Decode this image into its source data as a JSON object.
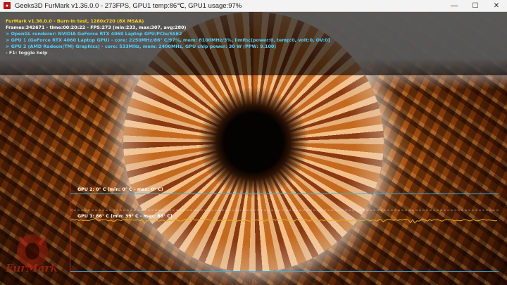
{
  "window": {
    "title": "Geeks3D FurMark v1.36.0.0 - 273FPS, GPU1 temp:86℃, GPU1 usage:97%",
    "icon": "furmark-app-icon",
    "controls": {
      "minimize": "—",
      "maximize": "☐",
      "close": "✕"
    }
  },
  "hud": {
    "lines": [
      {
        "text": "FurMark v1.36.0.0 - Burn-in test, 1280x720 (8X MSAA)",
        "color": "#ffd21a"
      },
      {
        "text": "Frames:342671 - time:00:20:22 - FPS:273 (min:233, max:307, avg:280)",
        "color": "#ffffff"
      },
      {
        "text": "> OpenGL renderer: NVIDIA GeForce RTX 4060 Laptop GPU/PCIe/SSE2",
        "color": "#4fd0ff"
      },
      {
        "text": "> GPU 1 (GeForce RTX 4060 Laptop GPU) - core: 2250MHz/86° C/97%, mem: 8100MHz/3%, limits:[power:0, temp:0, volt:0, OV:0]",
        "color": "#4fd0ff"
      },
      {
        "text": "> GPU 2 (AMD Radeon(TM) Graphics) - core: 533MHz, mem: 2400MHz, GPU chip power: 30 W (PPW: 9.100)",
        "color": "#4fd0ff"
      },
      {
        "text": "- F1: toggle help",
        "color": "#e2e2e2"
      }
    ]
  },
  "graphs": {
    "gpu2": {
      "label": "GPU 2: 0° C (min: 0° C - max: 0° C)",
      "line_color": "#3fb0d8"
    },
    "gpu1": {
      "label": "GPU 1: 86° C (min: 39° C - max: 88° C)",
      "line_color": "#e0b020"
    }
  },
  "logo": {
    "text": "FurMark"
  }
}
